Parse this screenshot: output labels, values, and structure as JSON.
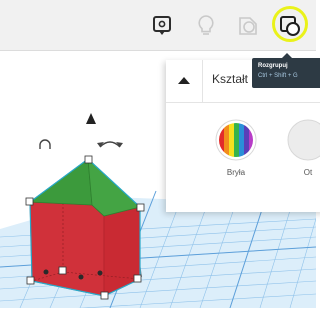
{
  "toolbar": {
    "buttons": [
      {
        "name": "notes-button",
        "icon": "speech-bubble-icon"
      },
      {
        "name": "light-bulb-button",
        "icon": "light-bulb-icon"
      },
      {
        "name": "group-button",
        "icon": "group-icon"
      },
      {
        "name": "ungroup-button",
        "icon": "ungroup-icon"
      }
    ],
    "highlight_color": "#eaf21a"
  },
  "tooltip": {
    "title": "Rozgrupuj",
    "shortcut": "Ctrl + Shift + G"
  },
  "panel": {
    "title": "Kształt",
    "items": [
      {
        "label": "Bryła",
        "icon": "rainbow-solid-icon"
      },
      {
        "label": "Ot",
        "icon": "hole-icon"
      }
    ]
  },
  "workplane": {
    "object_colors": {
      "body": "#cf2a2f",
      "roof": "#3c9a3c",
      "grid": "#7ab4e6",
      "outline": "#27a9c9"
    }
  }
}
